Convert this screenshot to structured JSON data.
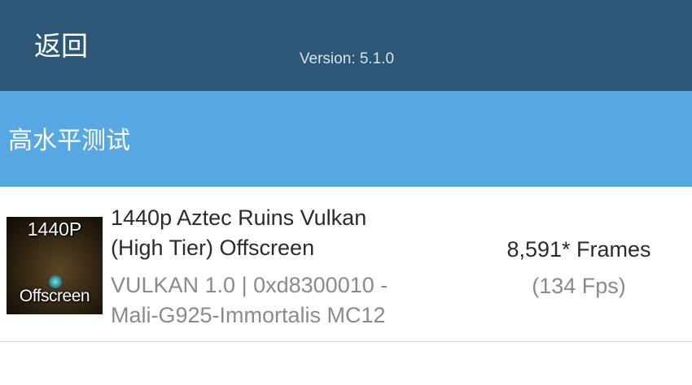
{
  "header": {
    "back_label": "返回",
    "version": "Version: 5.1.0",
    "background_color": "#2d5777"
  },
  "section": {
    "title": "高水平测试",
    "background_color": "#57a8e2"
  },
  "results": [
    {
      "thumbnail": {
        "top_label": "1440P",
        "bottom_label": "Offscreen"
      },
      "name_line1": "1440p Aztec Ruins Vulkan",
      "name_line2": "(High Tier) Offscreen",
      "detail_line1": "VULKAN 1.0 | 0xd8300010 -",
      "detail_line2": "Mali-G925-Immortalis MC12",
      "score": "8,591* Frames",
      "fps": "(134 Fps)"
    }
  ]
}
